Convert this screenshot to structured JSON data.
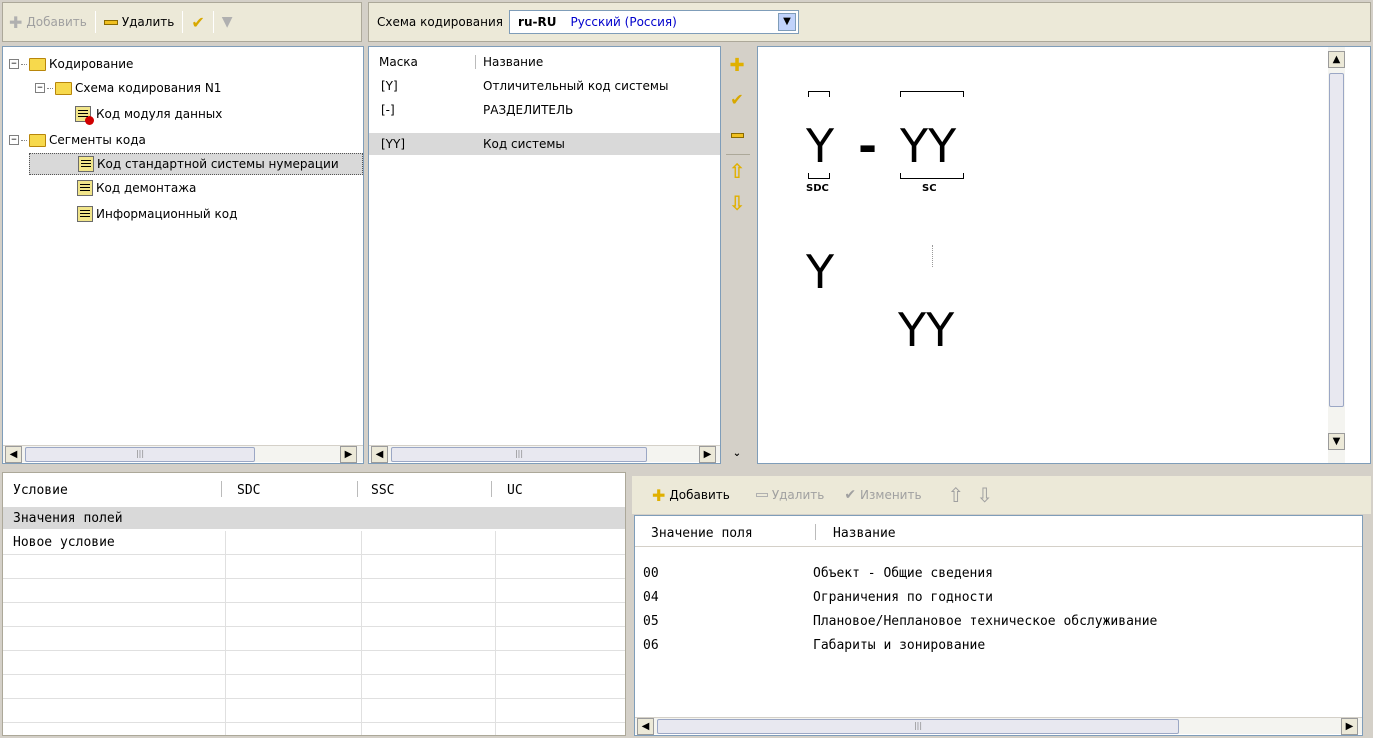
{
  "top_toolbar": {
    "add_label": "Добавить",
    "delete_label": "Удалить"
  },
  "encoding": {
    "label": "Схема кодирования",
    "code": "ru-RU",
    "name": "Русский (Россия)"
  },
  "tree": {
    "items": [
      {
        "label": "Кодирование"
      },
      {
        "label": "Схема кодирования N1"
      },
      {
        "label": "Код модуля данных"
      },
      {
        "label": "Сегменты кода"
      },
      {
        "label": "Код стандартной системы нумерации"
      },
      {
        "label": "Код демонтажа"
      },
      {
        "label": "Информационный код"
      }
    ]
  },
  "mask_list": {
    "headers": [
      "Маска",
      "Название"
    ],
    "rows": [
      {
        "mask": "[Y]",
        "name": "Отличительный код системы"
      },
      {
        "mask": "[-]",
        "name": "РАЗДЕЛИТЕЛЬ"
      },
      {
        "mask": "[YY]",
        "name": "Код системы"
      }
    ]
  },
  "preview": {
    "top_y": "Y",
    "dash": "-",
    "top_yy": "YY",
    "sdc": "SDC",
    "sc": "SC",
    "mid_y": "Y",
    "bottom_yy": "YY"
  },
  "conditions": {
    "headers": [
      "Условие",
      "SDC",
      "SSC",
      "UC"
    ],
    "rows": [
      {
        "label": "Значения полей"
      },
      {
        "label": "Новое условие"
      }
    ]
  },
  "values_toolbar": {
    "add_label": "Добавить",
    "delete_label": "Удалить",
    "edit_label": "Изменить"
  },
  "values": {
    "headers": [
      "Значение поля",
      "Название"
    ],
    "rows": [
      {
        "value": "00",
        "name": "Объект - Общие сведения"
      },
      {
        "value": "04",
        "name": "Ограничения по годности"
      },
      {
        "value": "05",
        "name": "Плановое/Неплановое техническое обслуживание"
      },
      {
        "value": "06",
        "name": "Габариты и зонирование"
      }
    ]
  },
  "colors": {
    "selection": "#d9d9d9",
    "window_bg": "#d4d0c8",
    "panel_border": "#7f9db9",
    "icon_yellow": "#f0c020",
    "link_blue": "#0000cc"
  }
}
